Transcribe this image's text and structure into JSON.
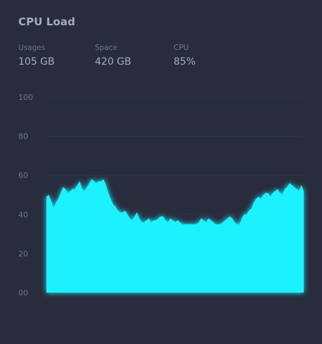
{
  "widget": {
    "title": "CPU Load"
  },
  "stats": [
    {
      "label": "Usages",
      "value": "105 GB"
    },
    {
      "label": "Space",
      "value": "420 GB"
    },
    {
      "label": "CPU",
      "value": "85%"
    }
  ],
  "colors": {
    "background": "#282c3d",
    "area_fill": "#1ef1ff",
    "gridline": "#30354a",
    "muted_text": "#6f758c",
    "primary_text": "#a7acc3"
  },
  "chart_data": {
    "type": "area",
    "title": "",
    "xlabel": "",
    "ylabel": "",
    "ylim": [
      0,
      100
    ],
    "yticks": [
      "00",
      "20",
      "40",
      "60",
      "80",
      "100"
    ],
    "grid": true,
    "series": [
      {
        "values": [
          49,
          50,
          47,
          43,
          46,
          48,
          51,
          54,
          53,
          51,
          52,
          53,
          53,
          55,
          57,
          53,
          52,
          54,
          56,
          58,
          57,
          56,
          57,
          57,
          58,
          55,
          51,
          48,
          45,
          44,
          42,
          41,
          41,
          42,
          40,
          38,
          37,
          39,
          41,
          38,
          36,
          36,
          37,
          38,
          36,
          37,
          37,
          38,
          39,
          39,
          37,
          36,
          38,
          37,
          36,
          37,
          36,
          35,
          35,
          35,
          35,
          35,
          35,
          35,
          36,
          38,
          37,
          36,
          38,
          37,
          36,
          35,
          35,
          35,
          36,
          37,
          38,
          39,
          38,
          36,
          35,
          35,
          38,
          40,
          40,
          42,
          43,
          46,
          48,
          49,
          48,
          50,
          51,
          51,
          49,
          51,
          52,
          53,
          51,
          50,
          53,
          54,
          56,
          55,
          54,
          53,
          52,
          55,
          52
        ]
      }
    ]
  }
}
